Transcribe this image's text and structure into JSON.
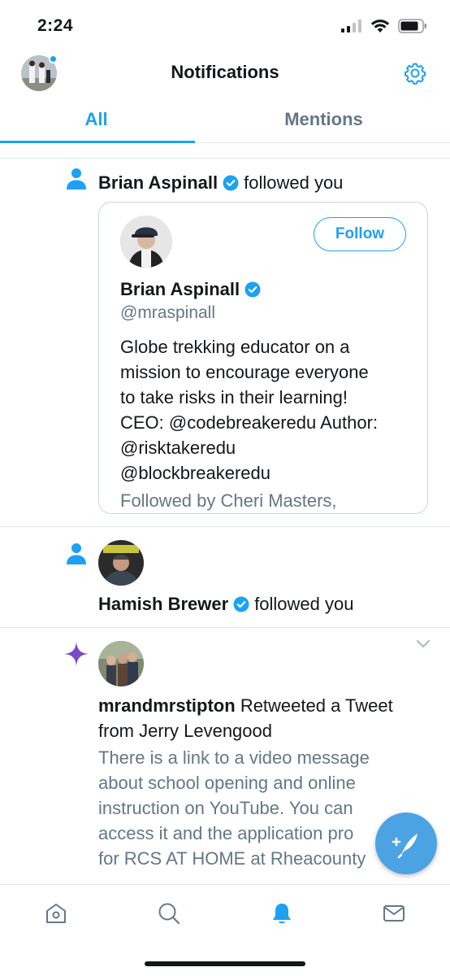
{
  "status_bar": {
    "time": "2:24"
  },
  "header": {
    "title": "Notifications"
  },
  "tabs": [
    {
      "label": "All",
      "active": true
    },
    {
      "label": "Mentions",
      "active": false
    }
  ],
  "notifications": [
    {
      "type": "follow",
      "icon": "person-icon",
      "user_name": "Brian Aspinall",
      "action": "followed you",
      "card": {
        "name": "Brian Aspinall",
        "handle": "@mraspinall",
        "follow_label": "Follow",
        "bio_lines": [
          "Globe trekking educator on a",
          "mission to encourage everyone",
          "to take risks in their learning!",
          "CEO: @codebreakeredu Author:",
          "@risktakeredu",
          "@blockbreakeredu"
        ],
        "followed_by": "Followed by Cheri Masters,"
      }
    },
    {
      "type": "follow",
      "icon": "person-icon",
      "user_name": "Hamish Brewer",
      "action": "followed you"
    },
    {
      "type": "retweet",
      "icon": "sparkle-icon",
      "user_name": "mrandmrstipton",
      "action_line1": "Retweeted a Tweet",
      "action_line2": "from Jerry Levengood",
      "body_lines": [
        "There is a link to a video message",
        "about school opening and online",
        "instruction on YouTube. You can",
        "access it and the application pro",
        "for RCS AT HOME at Rheacounty"
      ]
    }
  ],
  "bottom_nav": [
    "home-icon",
    "search-icon",
    "bell-icon",
    "mail-icon"
  ],
  "colors": {
    "accent": "#1da1f2",
    "muted": "#657786",
    "text": "#14171a",
    "border": "#e1e8ed",
    "sparkle": "#794bc4"
  }
}
